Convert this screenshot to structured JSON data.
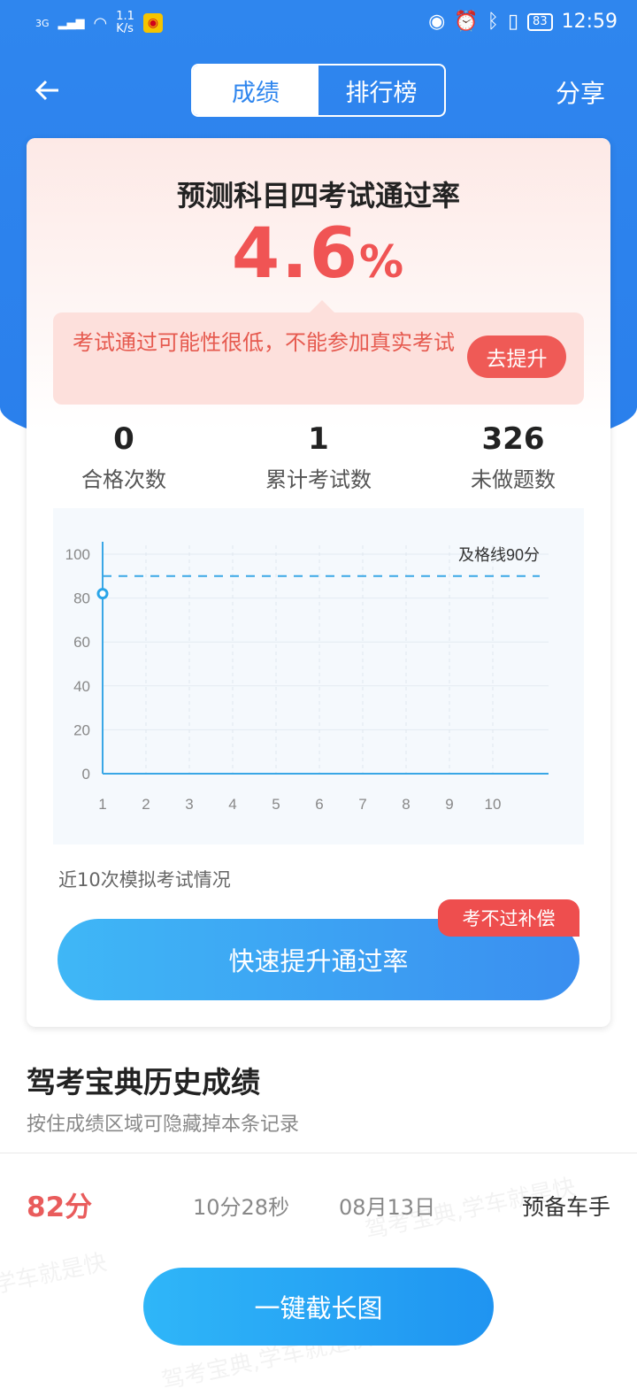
{
  "status": {
    "network": "3G",
    "speed_top": "1.1",
    "speed_bottom": "K/s",
    "battery": "83",
    "time": "12:59"
  },
  "topbar": {
    "tabs": [
      "成绩",
      "排行榜"
    ],
    "share_label": "分享"
  },
  "card": {
    "title": "预测科目四考试通过率",
    "rate_value": "4.6",
    "rate_unit": "%",
    "warning_text": "考试通过可能性很低，不能参加真实考试",
    "improve_button": "去提升",
    "stats": [
      {
        "value": "0",
        "label": "合格次数"
      },
      {
        "value": "1",
        "label": "累计考试数"
      },
      {
        "value": "326",
        "label": "未做题数"
      }
    ],
    "chart_caption": "近10次模拟考试情况",
    "cta_label": "快速提升通过率",
    "cta_badge": "考不过补偿"
  },
  "chart_data": {
    "type": "line",
    "x": [
      1,
      2,
      3,
      4,
      5,
      6,
      7,
      8,
      9,
      10
    ],
    "series": [
      {
        "values": [
          82
        ]
      }
    ],
    "ylim": [
      0,
      100
    ],
    "yticks": [
      0,
      20,
      40,
      60,
      80,
      100
    ],
    "pass_line": {
      "value": 90,
      "label": "及格线90分"
    },
    "grid": true
  },
  "history": {
    "title": "驾考宝典历史成绩",
    "subtitle": "按住成绩区域可隐藏掉本条记录",
    "records": [
      {
        "score": "82分",
        "duration": "10分28秒",
        "date": "08月13日",
        "rank": "预备车手"
      }
    ]
  },
  "watermark_text": "驾考宝典,学车就是快",
  "bottom_button": "一键截长图",
  "colors": {
    "primary": "#2f86ee",
    "accent": "#f05454"
  }
}
